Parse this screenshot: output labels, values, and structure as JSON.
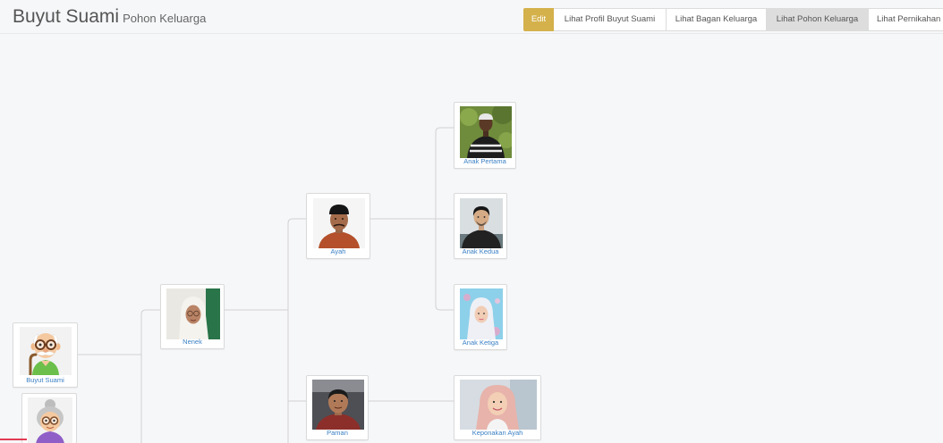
{
  "header": {
    "title": "Buyut Suami",
    "subtitle": "Pohon Keluarga"
  },
  "actions": [
    {
      "label": "Edit",
      "active": false
    },
    {
      "label": "Lihat Profil Buyut Suami",
      "active": false
    },
    {
      "label": "Lihat Bagan Keluarga",
      "active": false
    },
    {
      "label": "Lihat Pohon Keluarga",
      "active": true
    },
    {
      "label": "Lihat Pernikahan",
      "active": false
    }
  ],
  "tree": {
    "members": [
      {
        "name": "Buyut Suami",
        "photo": "cartoon-grandfather-avatar"
      },
      {
        "photo": "cartoon-grandmother-avatar"
      },
      {
        "name": "Nenek",
        "photo": "woman-hijab-photo"
      },
      {
        "name": "Ayah",
        "photo": "man-peci-photo"
      },
      {
        "name": "Paman",
        "photo": "man-photo"
      },
      {
        "name": "Anak Pertama",
        "photo": "man-outdoor-photo"
      },
      {
        "name": "Anak Kedua",
        "photo": "man-photo"
      },
      {
        "name": "Anak Ketiga",
        "photo": "woman-hijab-photo"
      },
      {
        "name": "Keponakan Ayah",
        "photo": "woman-hijab-photo"
      }
    ]
  },
  "colors": {
    "edit_button": "#d4b14b",
    "active_tab": "#dddddd",
    "member_link": "#3a7fc4",
    "connector": "#d2d2d2",
    "background": "#f6f7f9",
    "highlight": "#e23a52"
  }
}
